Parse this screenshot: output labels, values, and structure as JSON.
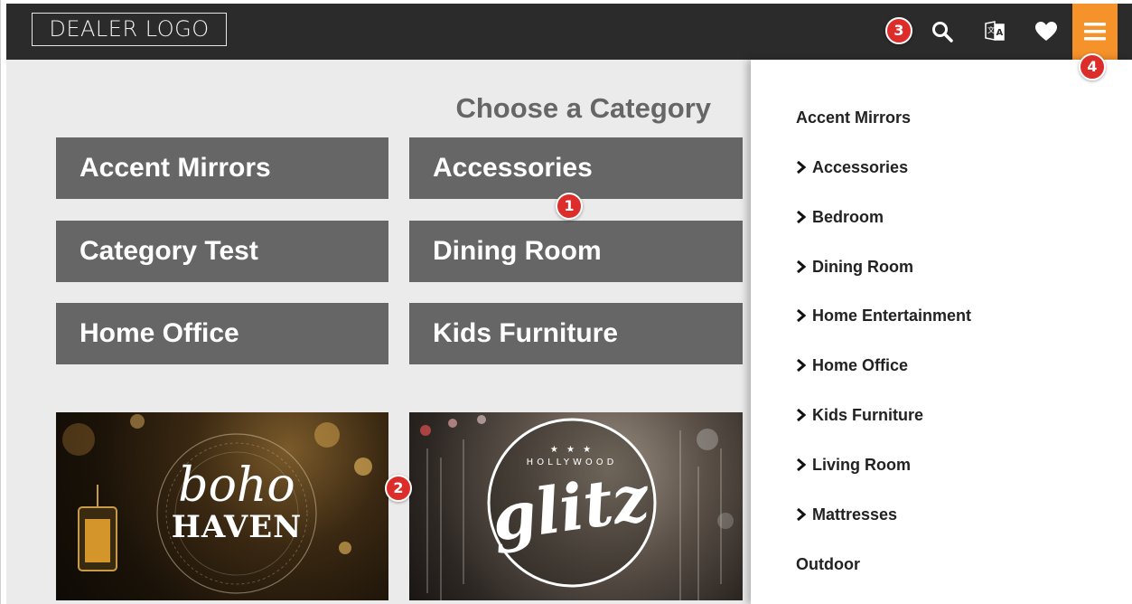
{
  "header": {
    "logo_text": "DEALER LOGO",
    "icons": [
      "search-icon",
      "translate-icon",
      "heart-icon",
      "hamburger-menu-icon"
    ],
    "accent_color": "#f5922a",
    "background_color": "#2b2b2b"
  },
  "annotations": {
    "badge_1": "1",
    "badge_2": "2",
    "badge_3": "3",
    "badge_4": "4",
    "badge_color": "#dd2d2a"
  },
  "main": {
    "title": "Choose a Category",
    "categories": [
      "Accent Mirrors",
      "Accessories",
      "Category Test",
      "Dining Room",
      "Home Office",
      "Kids Furniture"
    ],
    "promos": [
      {
        "brand_small": "",
        "brand_large_1": "boho",
        "brand_large_2": "HAVEN"
      },
      {
        "brand_small": "HOLLYWOOD",
        "brand_large_1": "glitz"
      }
    ]
  },
  "drawer": {
    "items": [
      {
        "label": "Accent Mirrors",
        "has_children": false
      },
      {
        "label": "Accessories",
        "has_children": true
      },
      {
        "label": "Bedroom",
        "has_children": true
      },
      {
        "label": "Dining Room",
        "has_children": true
      },
      {
        "label": "Home Entertainment",
        "has_children": true
      },
      {
        "label": "Home Office",
        "has_children": true
      },
      {
        "label": "Kids Furniture",
        "has_children": true
      },
      {
        "label": "Living Room",
        "has_children": true
      },
      {
        "label": "Mattresses",
        "has_children": true
      },
      {
        "label": "Outdoor",
        "has_children": false
      }
    ]
  }
}
